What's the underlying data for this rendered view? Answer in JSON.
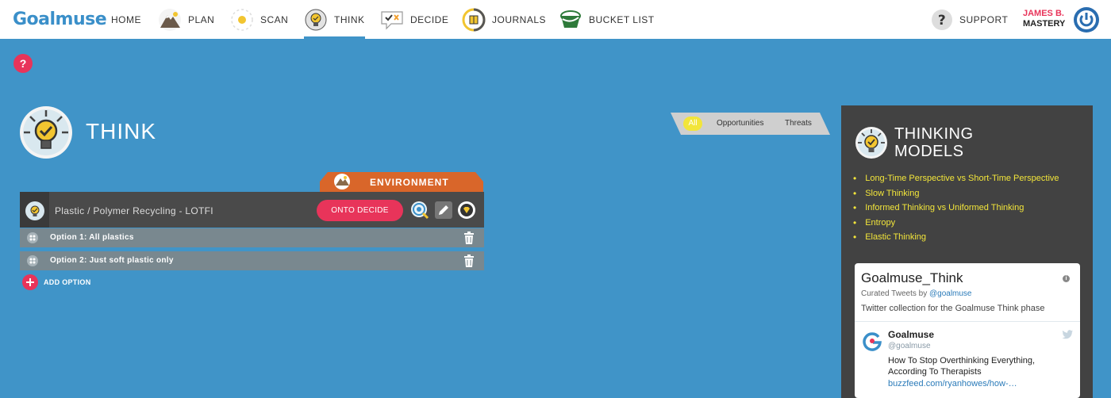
{
  "brand": {
    "logo_text": "Goalmuse"
  },
  "nav": {
    "items": [
      {
        "label": "HOME",
        "icon": "home"
      },
      {
        "label": "PLAN",
        "icon": "mountain-icon"
      },
      {
        "label": "SCAN",
        "icon": "sun-icon"
      },
      {
        "label": "THINK",
        "icon": "lightbulb-icon",
        "active": true
      },
      {
        "label": "DECIDE",
        "icon": "check-x-icon"
      },
      {
        "label": "JOURNALS",
        "icon": "journal-icon"
      },
      {
        "label": "BUCKET LIST",
        "icon": "bucket-icon"
      }
    ],
    "support_label": "SUPPORT",
    "user_first": "JAMES B.",
    "user_last": "MASTERY"
  },
  "help_label": "?",
  "page": {
    "title": "THINK"
  },
  "filters": {
    "all": "All",
    "opportunities": "Opportunities",
    "threats": "Threats"
  },
  "decision": {
    "category": "ENVIRONMENT",
    "title": "Plastic / Polymer Recycling - LOTFI",
    "onto_button": "ONTO DECIDE",
    "options": [
      {
        "label": "Option 1:  All plastics"
      },
      {
        "label": "Option 2:  Just soft plastic only"
      }
    ],
    "add_option": "ADD OPTION"
  },
  "thinking_models": {
    "title_line1": "THINKING",
    "title_line2": "MODELS",
    "items": [
      "Long-Time Perspective vs Short-Time Perspective",
      "Slow Thinking",
      "Informed Thinking vs Uniformed Thinking",
      "Entropy",
      "Elastic Thinking"
    ]
  },
  "twitter": {
    "collection_name": "Goalmuse_Think",
    "curated_prefix": "Curated Tweets by ",
    "curated_handle": "@goalmuse",
    "description": "Twitter collection for the Goalmuse Think phase",
    "tweet": {
      "author": "Goalmuse",
      "handle": "@goalmuse",
      "text": "How To Stop Overthinking Everything, According To Therapists",
      "link": "buzzfeed.com/ryanhowes/how-…"
    }
  },
  "colors": {
    "accent": "#e8345a",
    "background": "#4094c8",
    "highlight": "#f2e53a",
    "panel": "#424242"
  }
}
